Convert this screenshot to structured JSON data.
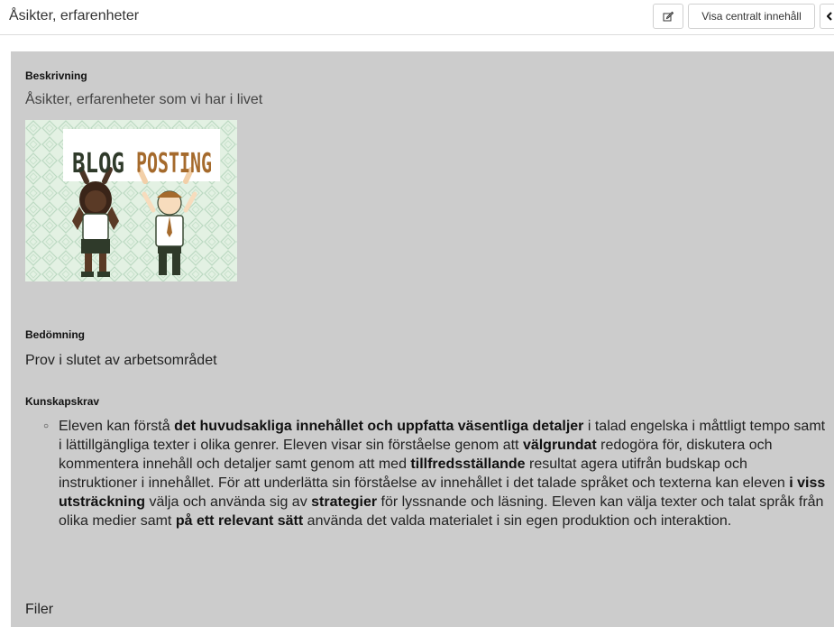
{
  "header": {
    "title": "Åsikter, erfarenheter",
    "edit_icon": "edit-icon",
    "central_button_label": "Visa centralt innehåll",
    "back_icon": "chevron-left-icon"
  },
  "content": {
    "description_label": "Beskrivning",
    "description_text": "Åsikter, erfarenheter som vi har i livet",
    "image": {
      "word1": "BLOG",
      "word2": "POSTING"
    },
    "assessment_label": "Bedömning",
    "assessment_text": "Prov i slutet av arbetsområdet",
    "requirements_label": "Kunskapskrav",
    "requirement": {
      "t1": "Eleven kan förstå ",
      "b1": "det huvudsakliga innehållet och uppfatta väsentliga detaljer",
      "t2": " i talad engelska i måttligt tempo samt i lättillgängliga texter i olika genrer. Eleven visar sin förståelse genom att ",
      "b2": "välgrundat",
      "t3": " redogöra för, diskutera och kommentera innehåll och detaljer samt genom att med ",
      "b3": "tillfredsställande",
      "t4": " resultat agera utifrån budskap och instruktioner i innehållet. För att underlätta sin förståelse av innehållet i det talade språket och texterna kan eleven ",
      "b4": "i viss utsträckning",
      "t5": " välja och använda sig av ",
      "b5": "strategier",
      "t6": " för lyssnande och läsning. Eleven kan välja texter och talat språk från olika medier samt ",
      "b6": "på ett relevant sätt",
      "t7": " använda det valda materialet i sin egen produktion och interaktion."
    },
    "files_label": "Filer"
  }
}
